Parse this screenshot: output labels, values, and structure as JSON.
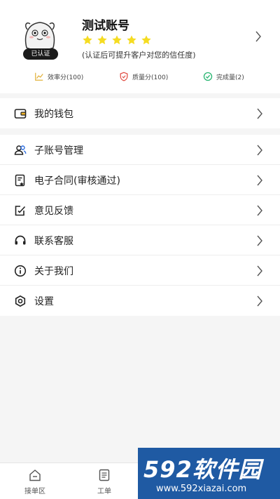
{
  "profile": {
    "name": "测试账号",
    "verified_badge": "已认证",
    "rating_stars": 5,
    "hint": "(认证后可提升客户对您的信任度)"
  },
  "metrics": [
    {
      "label": "效率分(100)",
      "icon": "trend-chart-icon",
      "color": "#e3b23c"
    },
    {
      "label": "质量分(100)",
      "icon": "shield-icon",
      "color": "#e0463c"
    },
    {
      "label": "完成量(2)",
      "icon": "check-circle-icon",
      "color": "#2bb673"
    }
  ],
  "wallet": {
    "label": "我的钱包",
    "icon": "wallet-icon"
  },
  "menu": [
    {
      "label": "子账号管理",
      "icon": "sub-accounts-icon"
    },
    {
      "label": "电子合同(审核通过)",
      "icon": "contract-icon"
    },
    {
      "label": "意见反馈",
      "icon": "feedback-icon"
    },
    {
      "label": "联系客服",
      "icon": "headset-icon"
    },
    {
      "label": "关于我们",
      "icon": "info-icon"
    },
    {
      "label": "设置",
      "icon": "settings-icon"
    }
  ],
  "tabbar": {
    "items": [
      {
        "label": "接单区",
        "icon": "home-icon"
      },
      {
        "label": "工单",
        "icon": "work-order-icon"
      }
    ]
  },
  "watermark": {
    "brand": "592软件园",
    "url": "www.592xiazai.com"
  },
  "colors": {
    "star": "#f5dc22",
    "accent_dark": "#1b1b1b",
    "watermark_bg": "#1f5aa3"
  }
}
